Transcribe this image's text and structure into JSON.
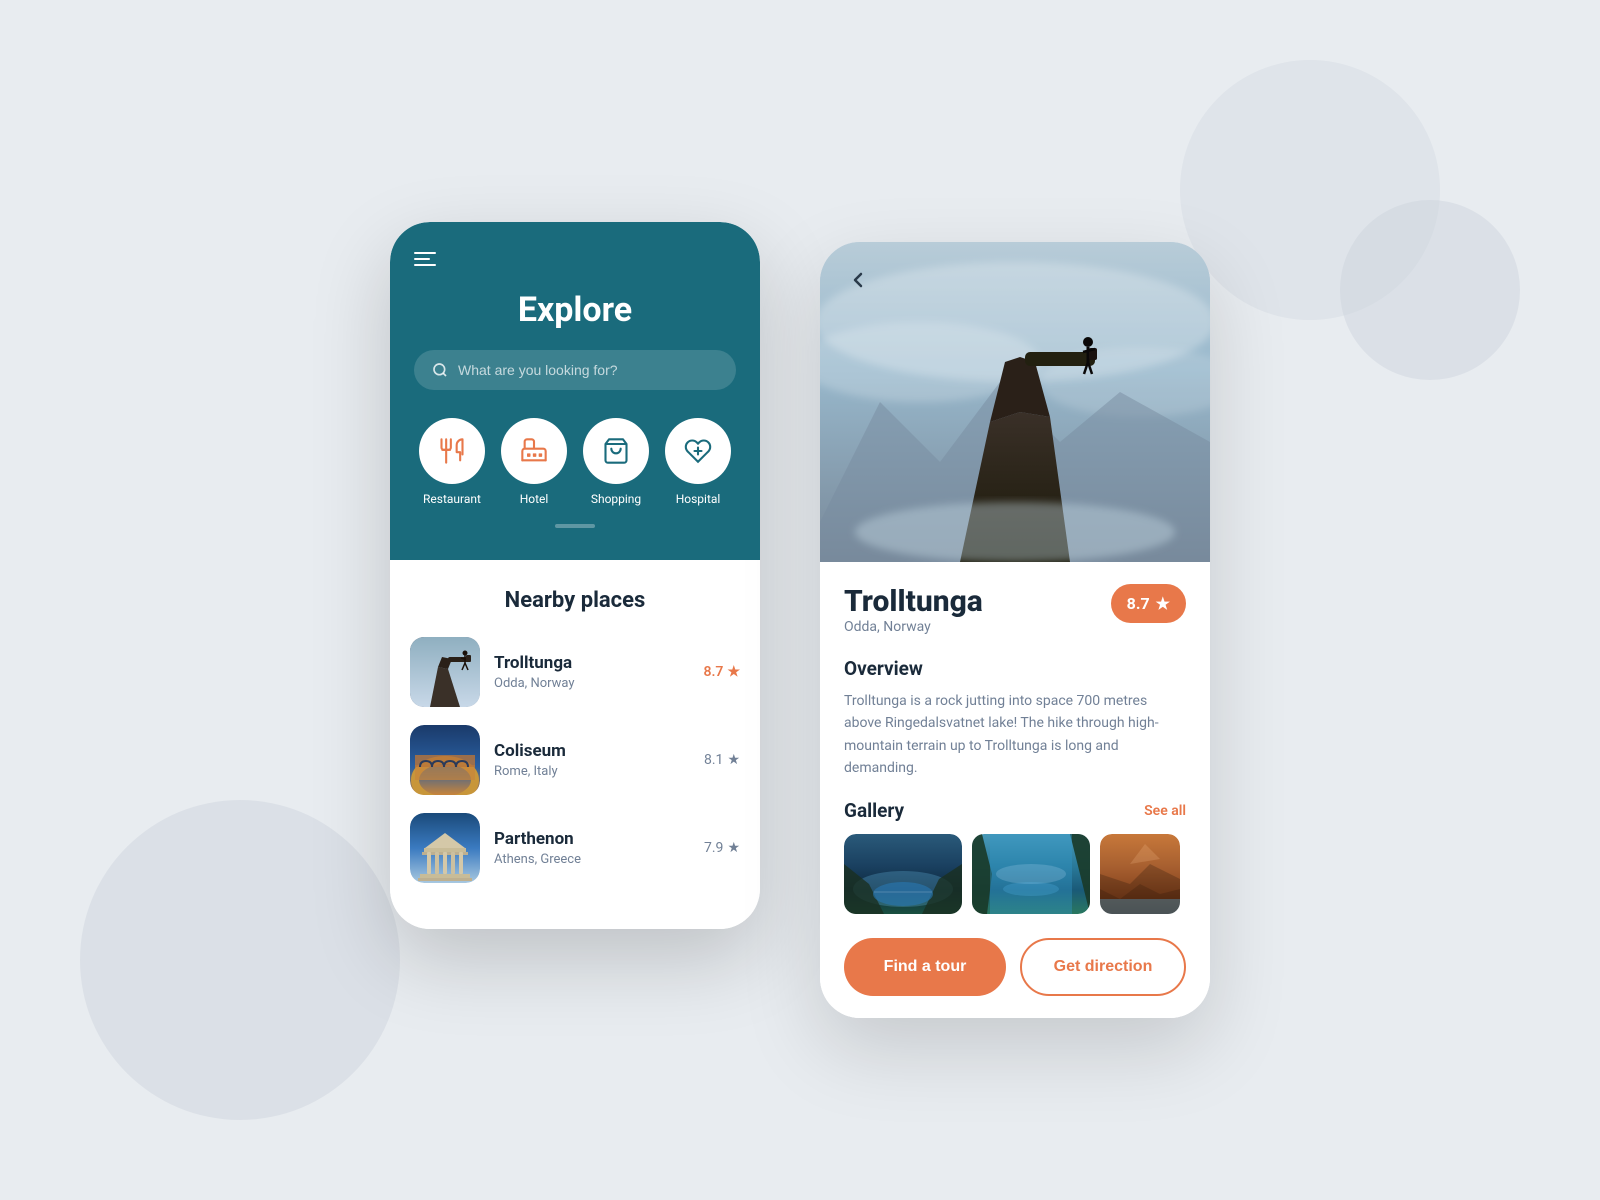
{
  "background": {
    "color": "#e8ecf0"
  },
  "phone1": {
    "title": "Explore",
    "search": {
      "placeholder": "What are you looking for?"
    },
    "categories": [
      {
        "id": "restaurant",
        "label": "Restaurant",
        "icon": "restaurant-icon"
      },
      {
        "id": "hotel",
        "label": "Hotel",
        "icon": "hotel-icon"
      },
      {
        "id": "shopping",
        "label": "Shopping",
        "icon": "shopping-icon"
      },
      {
        "id": "hospital",
        "label": "Hospital",
        "icon": "hospital-icon"
      }
    ],
    "nearby": {
      "title": "Nearby places",
      "places": [
        {
          "name": "Trolltunga",
          "location": "Odda, Norway",
          "rating": "8.7",
          "ratingHighlight": true
        },
        {
          "name": "Coliseum",
          "location": "Rome, Italy",
          "rating": "8.1",
          "ratingHighlight": false
        },
        {
          "name": "Parthenon",
          "location": "Athens, Greece",
          "rating": "7.9",
          "ratingHighlight": false
        }
      ]
    }
  },
  "phone2": {
    "back_label": "‹",
    "place_name": "Trolltunga",
    "place_location": "Odda, Norway",
    "rating": "8.7",
    "rating_star": "★",
    "overview_title": "Overview",
    "overview_text": "Trolltunga is a rock jutting into space 700 metres above Ringedalsvatnet lake! The hike through high-mountain terrain up to Trolltunga is long and demanding.",
    "gallery_title": "Gallery",
    "see_all_label": "See all",
    "button_find_tour": "Find a tour",
    "button_get_direction": "Get direction"
  }
}
